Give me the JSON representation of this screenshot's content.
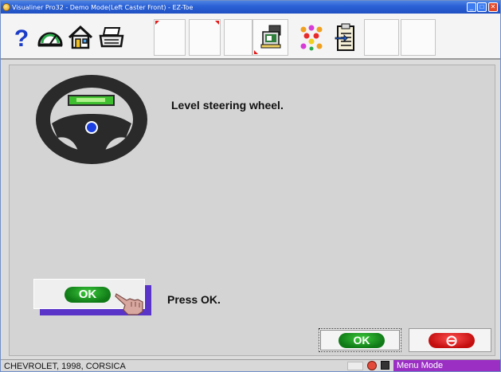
{
  "window": {
    "title": "Visualiner Pro32 - Demo Mode(Left Caster Front) - EZ-Toe",
    "controls": {
      "minimize": "_",
      "maximize": "□",
      "close": "✕"
    }
  },
  "toolbar": {
    "buttons": [
      {
        "icon": "help-icon"
      },
      {
        "icon": "speedometer-icon"
      },
      {
        "icon": "home-icon"
      },
      {
        "icon": "printer-icon"
      },
      {
        "icon": "blank"
      },
      {
        "icon": "blank"
      },
      {
        "icon": "specs-icon"
      },
      {
        "icon": "target-dots-icon"
      },
      {
        "icon": "clipboard-icon"
      },
      {
        "icon": "blank"
      },
      {
        "icon": "blank"
      }
    ]
  },
  "main": {
    "instruction": "Level steering wheel.",
    "press_ok_text": "Press OK.",
    "big_ok_label": "OK",
    "ok_label": "OK"
  },
  "statusbar": {
    "vehicle": "CHEVROLET, 1998, CORSICA",
    "mode": "Menu Mode"
  },
  "colors": {
    "titlebar": "#2b62d6",
    "ok_green": "#1a9a22",
    "cancel_red": "#e01c1c",
    "button_shadow": "#5a34c8",
    "menu_mode_bg": "#9b2fc4"
  }
}
